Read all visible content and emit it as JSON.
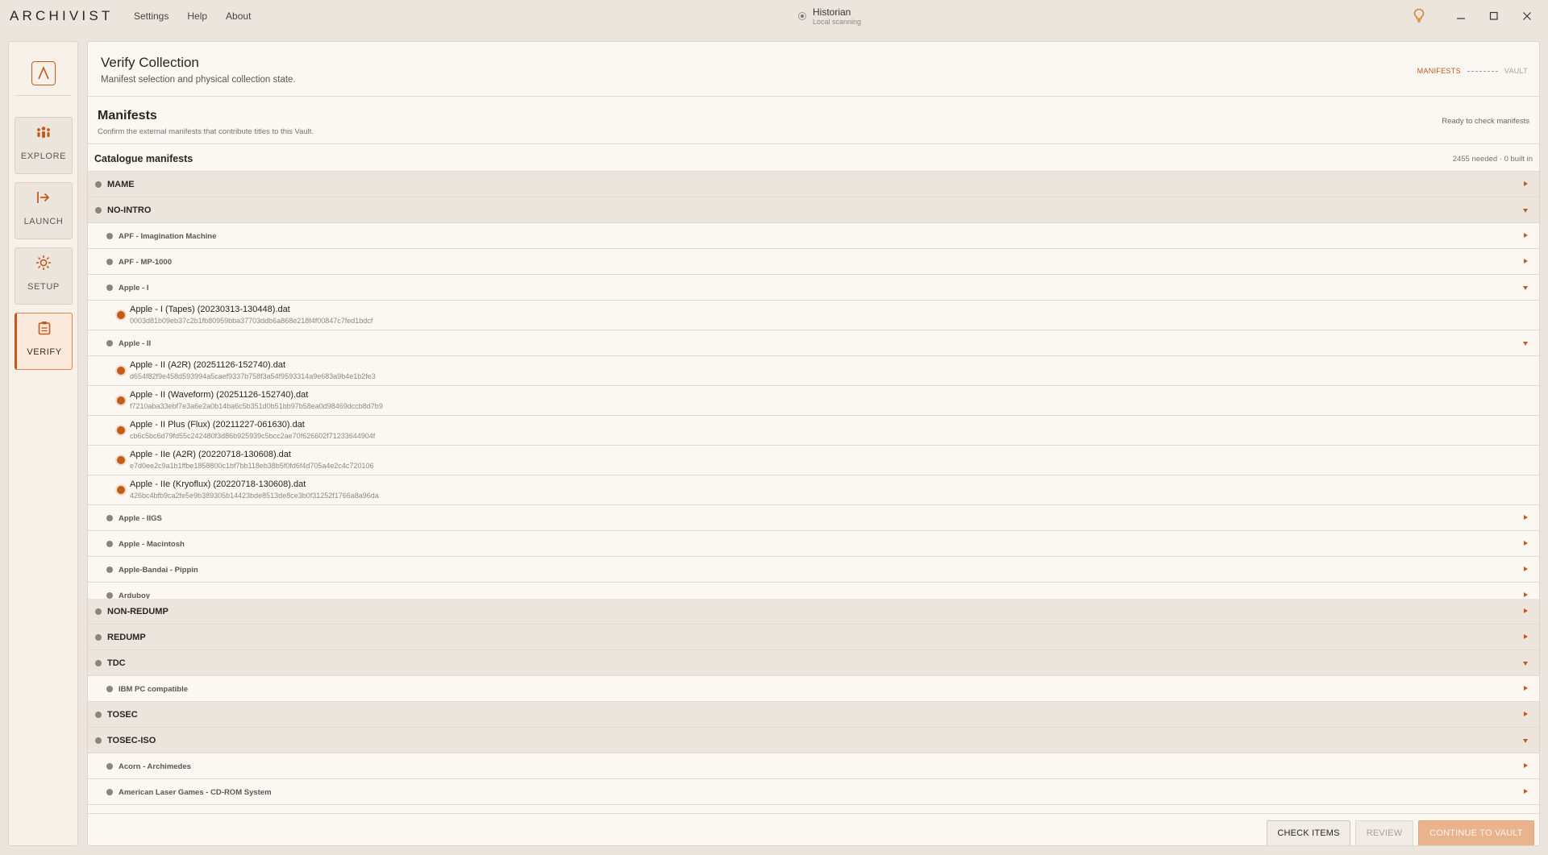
{
  "app": {
    "logo": "ARCHIVIST",
    "menu": [
      "Settings",
      "Help",
      "About"
    ],
    "user": {
      "name": "Historian",
      "status": "Local scanning"
    },
    "accent": "#c25b1c"
  },
  "nav": [
    {
      "label": "EXPLORE",
      "icon": "people-icon",
      "active": false
    },
    {
      "label": "LAUNCH",
      "icon": "launch-icon",
      "active": false
    },
    {
      "label": "SETUP",
      "icon": "sun-icon",
      "active": false
    },
    {
      "label": "VERIFY",
      "icon": "clipboard-icon",
      "active": true
    }
  ],
  "page": {
    "title": "Verify Collection",
    "subtitle": "Manifest selection and physical collection state.",
    "steps": {
      "current": "MANIFESTS",
      "next": "VAULT"
    }
  },
  "section": {
    "title": "Manifests",
    "subtitle": "Confirm the external manifests that contribute titles to this Vault.",
    "status": "Ready to check manifests"
  },
  "catalogue": {
    "title": "Catalogue manifests",
    "count": "2455 needed · 0 built in"
  },
  "tree": {
    "mame": "MAME",
    "nointro": "NO-INTRO",
    "nointro_items": {
      "apf_im": "APF - Imagination Machine",
      "apf_mp": "APF - MP-1000",
      "apple1": "Apple - I",
      "apple1_file": {
        "name": "Apple - I (Tapes) (20230313-130448).dat",
        "hash": "0003d81b09eb37c2b1fb80959bba37703ddb6a868e218f4f00847c7fed1bdcf"
      },
      "apple2": "Apple - II",
      "apple2_files": [
        {
          "name": "Apple - II (A2R) (20251126-152740).dat",
          "hash": "d654f82f9e458d593994a5caef9337b758f3a54f9593314a9e683a9b4e1b2fe3"
        },
        {
          "name": "Apple - II (Waveform) (20251126-152740).dat",
          "hash": "f7210aba33ebf7e3a6e2a0b14ba6c5b351d0b51bb97b58ea0d98469dccb8d7b9"
        },
        {
          "name": "Apple - II Plus (Flux) (20211227-061630).dat",
          "hash": "cb6c5bc6d79fd55c242480f3d86b925939c5bcc2ae70f626602f71233644904f"
        },
        {
          "name": "Apple - IIe (A2R) (20220718-130608).dat",
          "hash": "e7d0ee2c9a1b1ffbe1858800c1bf7bb118eb38b5f0fd6f4d705a4e2c4c720106"
        },
        {
          "name": "Apple - IIe (Kryoflux) (20220718-130608).dat",
          "hash": "426bc4bfb9ca2fe5e9b389305b14423bde8513de8ce3b0f31252f1766a8a96da"
        }
      ],
      "apple2gs": "Apple - IIGS",
      "mac": "Apple - Macintosh",
      "pippin": "Apple-Bandai - Pippin",
      "arduboy": "Arduboy"
    },
    "nonredump": "NON-REDUMP",
    "redump": "REDUMP",
    "tdc": "TDC",
    "tdc_items": [
      "IBM PC compatible"
    ],
    "tosec": "TOSEC",
    "tosec_iso": "TOSEC-ISO",
    "tosec_iso_items": [
      "Acorn - Archimedes",
      "American Laser Games - CD-ROM System"
    ]
  },
  "footer": {
    "check": "CHECK ITEMS",
    "review": "REVIEW",
    "continue": "CONTINUE TO VAULT"
  }
}
